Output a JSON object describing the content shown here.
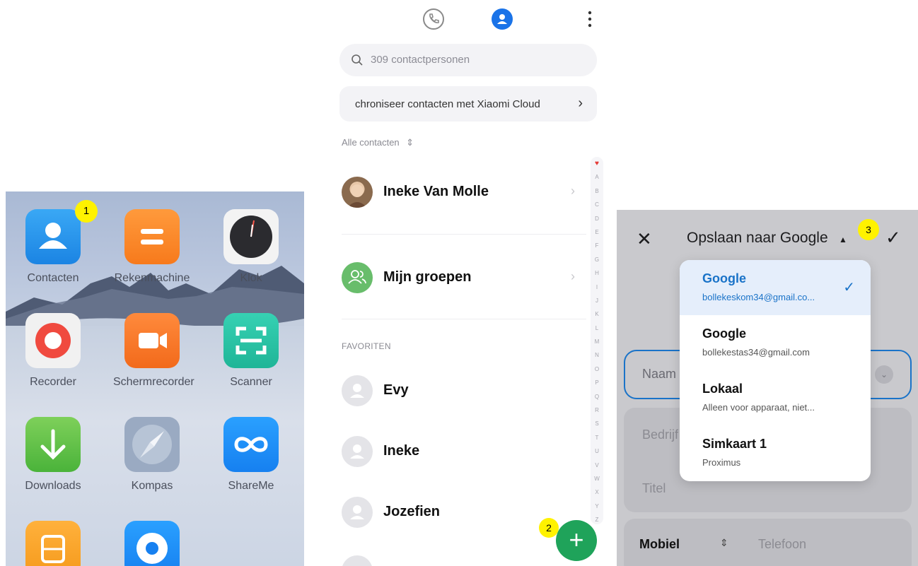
{
  "home": {
    "apps": [
      {
        "label": "Contacten",
        "icon": "contacts-icon"
      },
      {
        "label": "Rekenmachine",
        "icon": "calculator-icon"
      },
      {
        "label": "Klok",
        "icon": "clock-icon"
      },
      {
        "label": "Recorder",
        "icon": "recorder-icon"
      },
      {
        "label": "Schermrecorder",
        "icon": "screen-recorder-icon"
      },
      {
        "label": "Scanner",
        "icon": "scanner-icon"
      },
      {
        "label": "Downloads",
        "icon": "downloads-icon"
      },
      {
        "label": "Kompas",
        "icon": "compass-icon"
      },
      {
        "label": "ShareMe",
        "icon": "shareme-icon"
      }
    ],
    "badge": "1"
  },
  "contacts": {
    "search_placeholder": "309 contactpersonen",
    "sync_label": "chroniseer contacten met Xiaomi Cloud",
    "filter_label": "Alle contacten",
    "rows": [
      {
        "name": "Ineke Van Molle"
      },
      {
        "name": "Mijn groepen"
      }
    ],
    "favorites_header": "FAVORITEN",
    "favorites": [
      {
        "name": "Evy"
      },
      {
        "name": "Ineke"
      },
      {
        "name": "Jozefien"
      }
    ],
    "index_letters": [
      "A",
      "B",
      "C",
      "D",
      "E",
      "F",
      "G",
      "H",
      "I",
      "J",
      "K",
      "L",
      "M",
      "N",
      "O",
      "P",
      "Q",
      "R",
      "S",
      "T",
      "U",
      "V",
      "W",
      "X",
      "Y",
      "Z"
    ],
    "fab_label": "+",
    "badge": "2",
    "colors": {
      "fab": "#1fa35a",
      "active_tab": "#1a73e8",
      "favorite_heart": "#e53935"
    }
  },
  "save_dialog": {
    "title": "Opslaan naar Google",
    "badge": "3",
    "fields": {
      "name_placeholder": "Naam",
      "company_placeholder": "Bedrijf",
      "title_placeholder": "Titel",
      "phone_type": "Mobiel",
      "phone_placeholder": "Telefoon"
    },
    "options": [
      {
        "title": "Google",
        "subtitle": "bollekeskom34@gmail.co...",
        "selected": true
      },
      {
        "title": "Google",
        "subtitle": "bollekestas34@gmail.com",
        "selected": false
      },
      {
        "title": "Lokaal",
        "subtitle": "Alleen voor apparaat, niet...",
        "selected": false
      },
      {
        "title": "Simkaart 1",
        "subtitle": "Proximus",
        "selected": false
      }
    ],
    "colors": {
      "accent": "#1a73c8"
    }
  }
}
